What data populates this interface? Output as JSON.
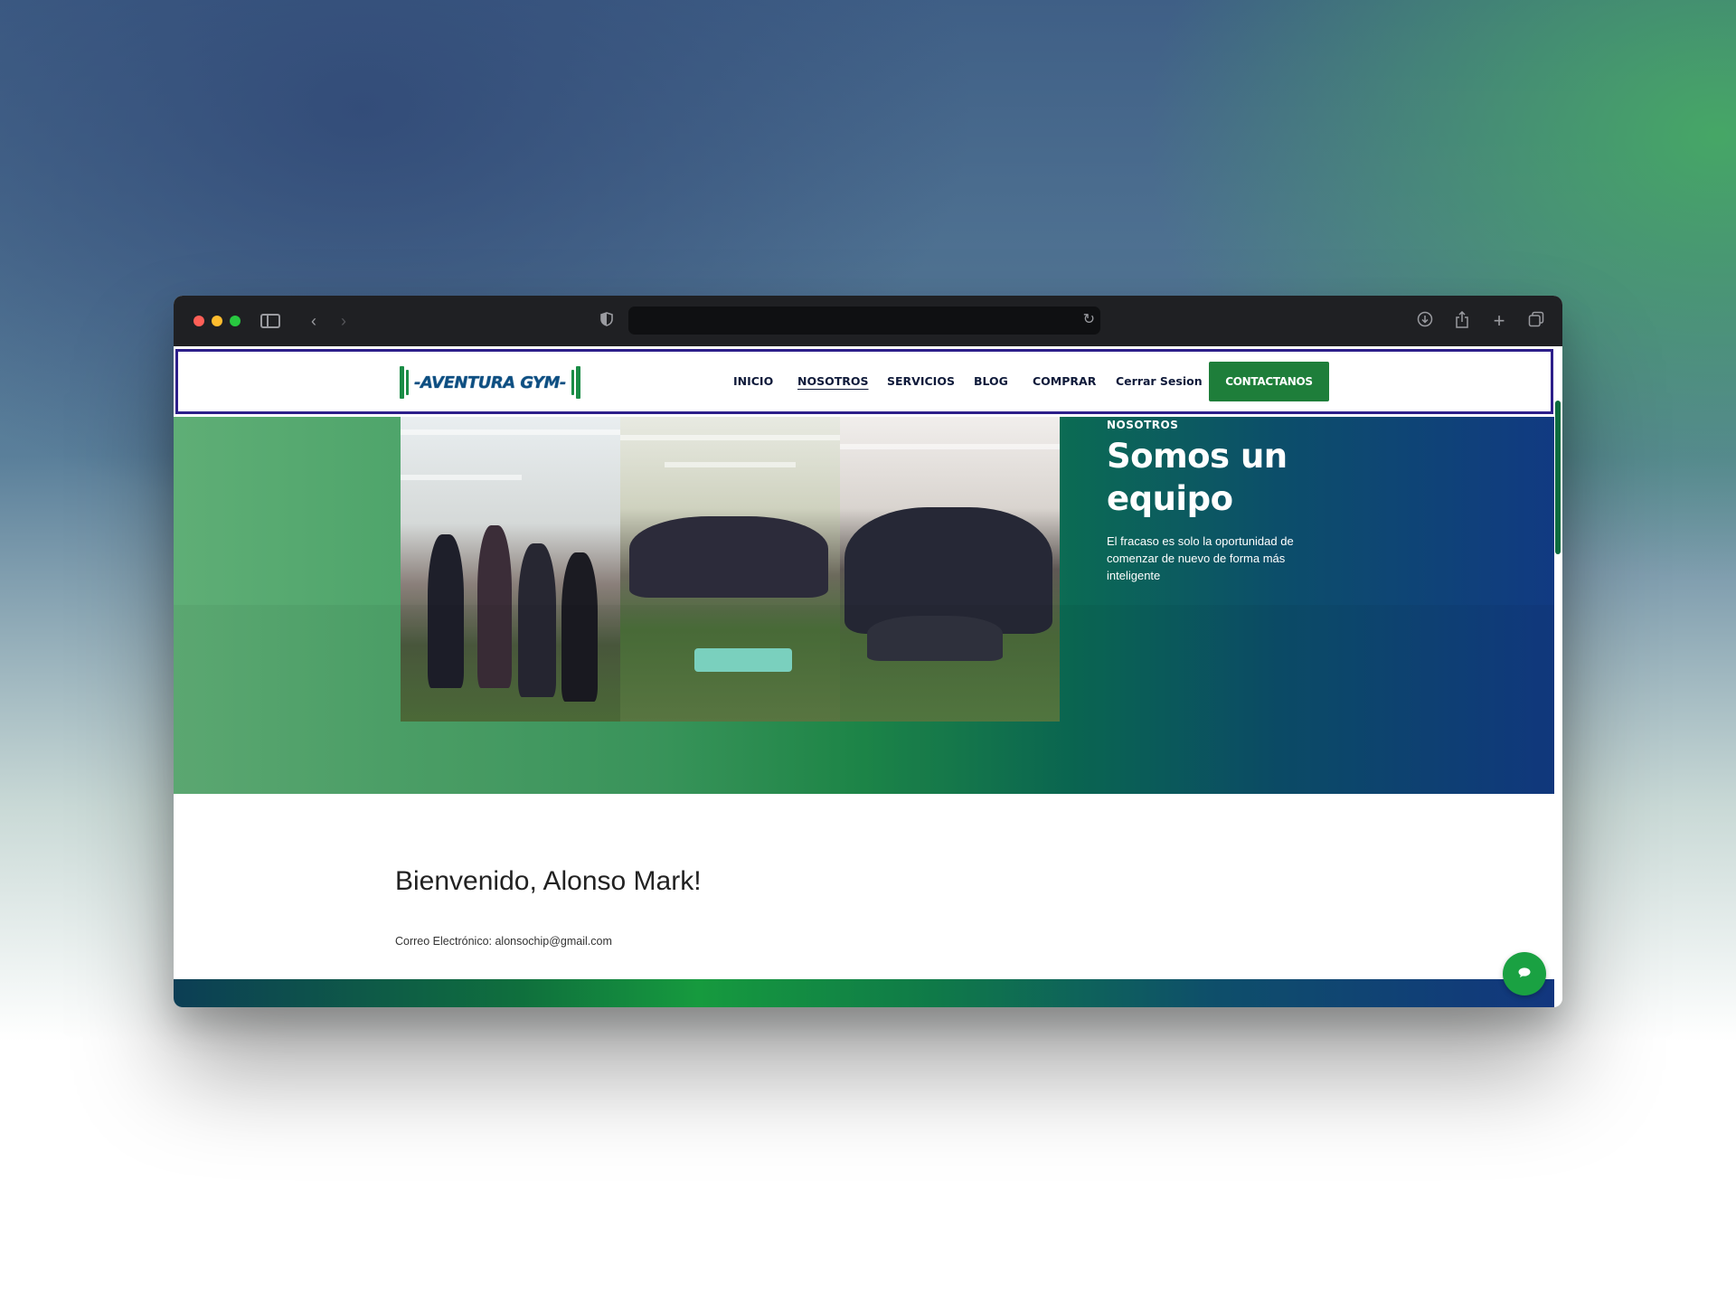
{
  "browser": {
    "url": "",
    "icons": [
      "sidebar-icon",
      "back-icon",
      "forward-icon",
      "shield-icon",
      "reload-icon",
      "download-icon",
      "share-icon",
      "new-tab-icon",
      "tabs-overview-icon"
    ]
  },
  "logo": {
    "text": "-AVENTURA GYM-"
  },
  "nav": {
    "items": [
      {
        "label": "INICIO"
      },
      {
        "label": "NOSOTROS",
        "active": true
      },
      {
        "label": "SERVICIOS"
      },
      {
        "label": "BLOG"
      },
      {
        "label": "COMPRAR"
      },
      {
        "label": "Cerrar Sesion"
      }
    ],
    "cta": "CONTACTANOS"
  },
  "hero": {
    "kicker": "NOSOTROS",
    "title": "Somos un equipo",
    "subtitle": "El fracaso es solo la oportunidad de comenzar de nuevo de forma más inteligente"
  },
  "profile": {
    "welcome": "Bienvenido, Alonso Mark!",
    "email_label": "Correo Electrónico: alonsochip@gmail.com"
  },
  "colors": {
    "brand_green": "#1e7e3a",
    "nav_text": "#0f1a3a",
    "nav_border": "#2d1f8a",
    "hero_left": "#5fae76",
    "hero_right": "#113a82"
  }
}
